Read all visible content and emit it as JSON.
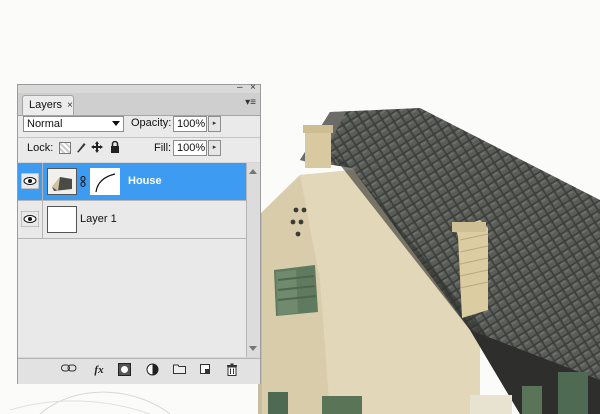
{
  "layers_panel": {
    "tab_label": "Layers",
    "close_glyph": "×",
    "collapse_glyph": "–",
    "win_close_glyph": "×",
    "menu_glyph": "▾≡",
    "blend_mode": "Normal",
    "opacity_label": "Opacity:",
    "opacity_value": "100%",
    "lock_label": "Lock:",
    "fill_label": "Fill:",
    "fill_value": "100%",
    "stepper_glyph": "▸",
    "layers": [
      {
        "name": "House",
        "selected": true,
        "visible": true,
        "has_mask": true
      },
      {
        "name": "Layer 1",
        "selected": false,
        "visible": true,
        "has_mask": false
      }
    ],
    "bottom_icons": [
      "link-layers-icon",
      "fx-icon",
      "add-mask-icon",
      "adjustment-layer-icon",
      "new-group-icon",
      "new-layer-icon",
      "trash-icon"
    ],
    "fx_glyph": "fx"
  },
  "colors": {
    "selection": "#3d9bf2",
    "panel_bg": "#e9e9e9"
  }
}
